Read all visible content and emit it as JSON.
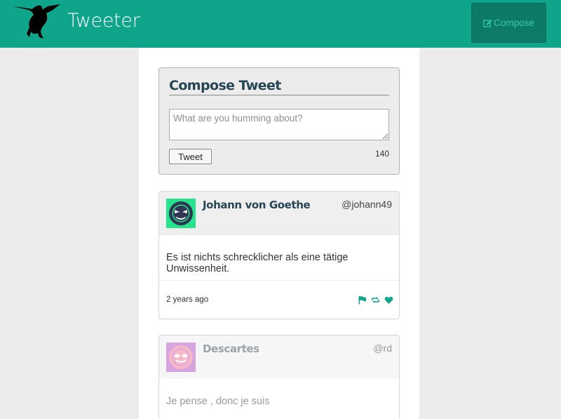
{
  "app": {
    "brand": "Tweeter",
    "logo_icon": "hummingbird-icon",
    "compose_label": "Compose",
    "compose_icon": "edit-icon"
  },
  "colors": {
    "accent": "#0fa58a",
    "compose_button": "#0d7a66",
    "title": "#264653",
    "avatar_1_bg": "#26e48b",
    "avatar_2_bg": "#cc8ad8"
  },
  "compose": {
    "title": "Compose Tweet",
    "placeholder": "What are you humming about?",
    "value": "",
    "button_label": "Tweet",
    "counter": "140"
  },
  "tweets": [
    {
      "name": "Johann von Goethe",
      "handle": "@johann49",
      "text": "Es ist nichts schrecklicher als eine tätige Unwissenheit.",
      "time": "2 years ago",
      "actions": [
        "flag-icon",
        "retweet-icon",
        "heart-icon"
      ]
    },
    {
      "name": "Descartes",
      "handle": "@rd",
      "text": "Je pense , donc je suis"
    }
  ]
}
